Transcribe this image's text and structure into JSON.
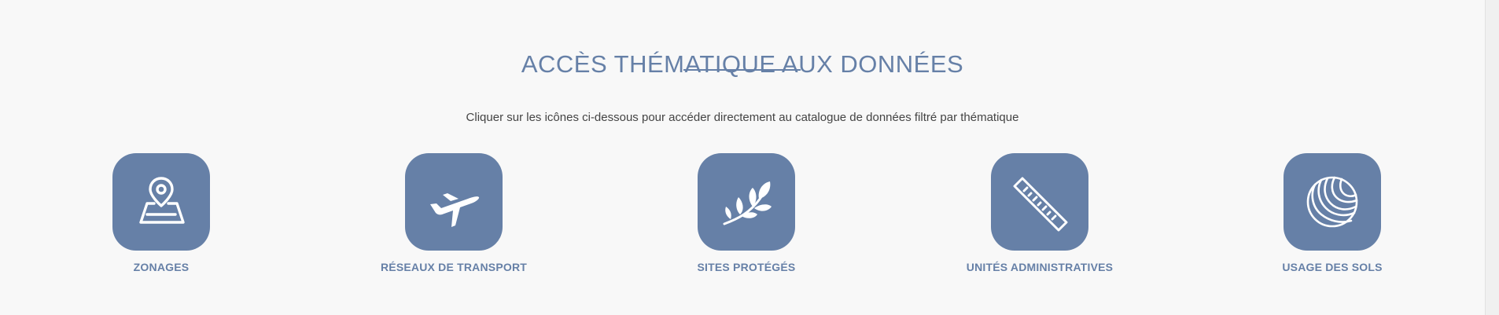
{
  "section": {
    "title": "ACCÈS THÉMATIQUE AUX DONNÉES",
    "subtitle": "Cliquer sur les icônes ci-dessous pour accéder directement au catalogue de données filtré par thématique"
  },
  "themes": [
    {
      "label": "ZONAGES",
      "icon": "map-pin-icon"
    },
    {
      "label": "RÉSEAUX DE TRANSPORT",
      "icon": "airplane-icon"
    },
    {
      "label": "SITES PROTÉGÉS",
      "icon": "leaf-branch-icon"
    },
    {
      "label": "UNITÉS ADMINISTRATIVES",
      "icon": "ruler-icon"
    },
    {
      "label": "USAGE DES SOLS",
      "icon": "land-use-icon"
    }
  ],
  "colors": {
    "accent": "#6680a7",
    "background": "#f8f8f8",
    "text": "#444444"
  }
}
